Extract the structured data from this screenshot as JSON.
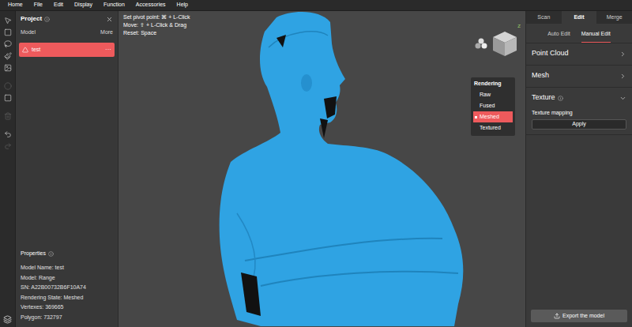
{
  "menu": [
    "Home",
    "File",
    "Edit",
    "Display",
    "Function",
    "Accessories",
    "Help"
  ],
  "toolbar": {
    "tools": [
      {
        "disabled": false
      },
      {
        "disabled": false
      },
      {
        "disabled": false
      },
      {
        "disabled": false
      },
      {
        "disabled": false
      },
      {
        "disabled": true
      },
      {
        "disabled": false
      },
      {
        "disabled": true
      },
      {
        "disabled": false
      },
      {
        "disabled": true
      }
    ]
  },
  "project": {
    "title": "Project",
    "column": "Model",
    "more": "More",
    "models": [
      {
        "name": "test",
        "menu": "···",
        "selected": true
      }
    ]
  },
  "properties": {
    "title": "Properties",
    "rows": [
      "Model Name: test",
      "Model: Range",
      "SN: A22B00732B6F10A74",
      "Rendering State: Meshed",
      "Vertexes: 369665",
      "Polygon: 732797"
    ]
  },
  "viewport": {
    "hints": [
      "Set pivot point: ⌘ + L-Click",
      "Move: ⇧ + L-Click & Drag",
      "Reset: Space"
    ],
    "view_cube": {
      "axis": "Z"
    }
  },
  "rendering": {
    "title": "Rendering",
    "options": [
      {
        "label": "Raw",
        "selected": false
      },
      {
        "label": "Fused",
        "selected": false
      },
      {
        "label": "Meshed",
        "selected": true
      },
      {
        "label": "Textured",
        "selected": false
      }
    ]
  },
  "right_panel": {
    "tabs": [
      {
        "label": "Scan",
        "selected": false
      },
      {
        "label": "Edit",
        "selected": true
      },
      {
        "label": "Merge",
        "selected": false
      }
    ],
    "modes": [
      {
        "label": "Auto Edit",
        "selected": false
      },
      {
        "label": "Manual Edit",
        "selected": true
      }
    ],
    "sections": [
      {
        "label": "Point Cloud",
        "expanded": false
      },
      {
        "label": "Mesh",
        "expanded": false
      },
      {
        "label": "Texture",
        "expanded": true
      }
    ],
    "texture_mapping": {
      "label": "Texture mapping",
      "button": "Apply"
    },
    "export_button": "Export the model"
  }
}
